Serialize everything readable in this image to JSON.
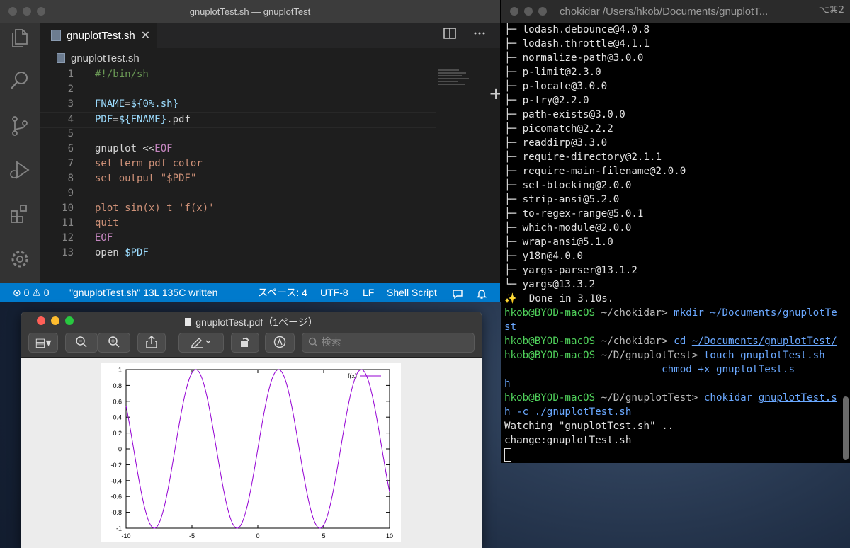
{
  "vscode": {
    "window_title": "gnuplotTest.sh — gnuplotTest",
    "tab_label": "gnuplotTest.sh",
    "tab_close": "✕",
    "breadcrumb": "gnuplotTest.sh",
    "split_icon": "split-editor-icon",
    "more_icon": "more-actions-icon",
    "activity_icons": [
      "explorer-icon",
      "search-icon",
      "source-control-icon",
      "run-debug-icon",
      "extensions-icon",
      "settings-gear-icon"
    ],
    "lines": [
      {
        "n": "1",
        "tokens": [
          {
            "t": "#!/bin/sh",
            "c": "c-comment"
          }
        ]
      },
      {
        "n": "2",
        "tokens": []
      },
      {
        "n": "3",
        "tokens": [
          {
            "t": "FNAME",
            "c": "c-var"
          },
          {
            "t": "=",
            "c": ""
          },
          {
            "t": "${0%.sh}",
            "c": "c-var"
          }
        ]
      },
      {
        "n": "4",
        "tokens": [
          {
            "t": "PDF",
            "c": "c-var"
          },
          {
            "t": "=",
            "c": ""
          },
          {
            "t": "${FNAME}",
            "c": "c-var"
          },
          {
            "t": ".pdf",
            "c": ""
          }
        ]
      },
      {
        "n": "5",
        "tokens": []
      },
      {
        "n": "6",
        "tokens": [
          {
            "t": "gnuplot <<",
            "c": ""
          },
          {
            "t": "EOF",
            "c": "c-kw"
          }
        ]
      },
      {
        "n": "7",
        "tokens": [
          {
            "t": "set term pdf color",
            "c": "c-orange"
          }
        ]
      },
      {
        "n": "8",
        "tokens": [
          {
            "t": "set output \"$PDF\"",
            "c": "c-orange"
          }
        ]
      },
      {
        "n": "9",
        "tokens": []
      },
      {
        "n": "10",
        "tokens": [
          {
            "t": "plot sin(x) t 'f(x)'",
            "c": "c-orange"
          }
        ]
      },
      {
        "n": "11",
        "tokens": [
          {
            "t": "quit",
            "c": "c-orange"
          }
        ]
      },
      {
        "n": "12",
        "tokens": [
          {
            "t": "EOF",
            "c": "c-kw"
          }
        ]
      },
      {
        "n": "13",
        "tokens": [
          {
            "t": "open ",
            "c": ""
          },
          {
            "t": "$PDF",
            "c": "c-var"
          }
        ]
      }
    ],
    "status": {
      "problems": "⊗ 0 ⚠ 0",
      "message": "\"gnuplotTest.sh\" 13L 135C written",
      "spaces": "スペース: 4",
      "encoding": "UTF-8",
      "eol": "LF",
      "language": "Shell Script"
    }
  },
  "terminal": {
    "title": "chokidar /Users/hkob/Documents/gnuplotT...",
    "shortcut": "⌥⌘2",
    "lines": [
      [
        {
          "t": "├─ lodash.debounce@4.0.8",
          "c": ""
        }
      ],
      [
        {
          "t": "├─ lodash.throttle@4.1.1",
          "c": ""
        }
      ],
      [
        {
          "t": "├─ normalize-path@3.0.0",
          "c": ""
        }
      ],
      [
        {
          "t": "├─ p-limit@2.3.0",
          "c": ""
        }
      ],
      [
        {
          "t": "├─ p-locate@3.0.0",
          "c": ""
        }
      ],
      [
        {
          "t": "├─ p-try@2.2.0",
          "c": ""
        }
      ],
      [
        {
          "t": "├─ path-exists@3.0.0",
          "c": ""
        }
      ],
      [
        {
          "t": "├─ picomatch@2.2.2",
          "c": ""
        }
      ],
      [
        {
          "t": "├─ readdirp@3.3.0",
          "c": ""
        }
      ],
      [
        {
          "t": "├─ require-directory@2.1.1",
          "c": ""
        }
      ],
      [
        {
          "t": "├─ require-main-filename@2.0.0",
          "c": ""
        }
      ],
      [
        {
          "t": "├─ set-blocking@2.0.0",
          "c": ""
        }
      ],
      [
        {
          "t": "├─ strip-ansi@5.2.0",
          "c": ""
        }
      ],
      [
        {
          "t": "├─ to-regex-range@5.0.1",
          "c": ""
        }
      ],
      [
        {
          "t": "├─ which-module@2.0.0",
          "c": ""
        }
      ],
      [
        {
          "t": "├─ wrap-ansi@5.1.0",
          "c": ""
        }
      ],
      [
        {
          "t": "├─ y18n@4.0.0",
          "c": ""
        }
      ],
      [
        {
          "t": "├─ yargs-parser@13.1.2",
          "c": ""
        }
      ],
      [
        {
          "t": "└─ yargs@13.3.2",
          "c": ""
        }
      ],
      [
        {
          "t": "✨  Done in 3.10s.",
          "c": ""
        }
      ],
      [
        {
          "t": "hkob@BYOD-macOS",
          "c": "t-green"
        },
        {
          "t": " ~/chokidar> ",
          "c": "t-prompt"
        },
        {
          "t": "mkdir ",
          "c": "t-blue"
        },
        {
          "t": "~/Documents/gnuplotTe",
          "c": "t-blue"
        }
      ],
      [
        {
          "t": "st",
          "c": "t-blue"
        }
      ],
      [
        {
          "t": "hkob@BYOD-macOS",
          "c": "t-green"
        },
        {
          "t": " ~/chokidar> ",
          "c": "t-prompt"
        },
        {
          "t": "cd ",
          "c": "t-blue"
        },
        {
          "t": "~/Documents/gnuplotTest/",
          "c": "t-blue t-under"
        }
      ],
      [
        {
          "t": "hkob@BYOD-macOS",
          "c": "t-green"
        },
        {
          "t": " ~/D/gnuplotTest> ",
          "c": "t-prompt"
        },
        {
          "t": "touch ",
          "c": "t-blue"
        },
        {
          "t": "gnuplotTest.sh",
          "c": "t-blue"
        }
      ],
      [
        {
          "t": "                          chmod ",
          "c": "t-blue"
        },
        {
          "t": "+x gnuplotTest.s",
          "c": "t-blue"
        }
      ],
      [
        {
          "t": "h",
          "c": "t-blue"
        }
      ],
      [
        {
          "t": "hkob@BYOD-macOS",
          "c": "t-green"
        },
        {
          "t": " ~/D/gnuplotTest> ",
          "c": "t-prompt"
        },
        {
          "t": "chokidar ",
          "c": "t-blue"
        },
        {
          "t": "gnuplotTest.s",
          "c": "t-blue t-under"
        }
      ],
      [
        {
          "t": "h",
          "c": "t-blue t-under"
        },
        {
          "t": " -c ",
          "c": "t-blue"
        },
        {
          "t": "./gnuplotTest.sh",
          "c": "t-blue t-under"
        }
      ],
      [
        {
          "t": "Watching \"gnuplotTest.sh\" ..",
          "c": ""
        }
      ],
      [
        {
          "t": "change:gnuplotTest.sh",
          "c": ""
        }
      ]
    ]
  },
  "preview": {
    "title": "gnuplotTest.pdf（1ページ）",
    "search_placeholder": "検索"
  },
  "chart_data": {
    "type": "line",
    "title": "",
    "xlabel": "",
    "ylabel": "",
    "xlim": [
      -10,
      10
    ],
    "ylim": [
      -1,
      1
    ],
    "xticks": [
      "-10",
      "-5",
      "0",
      "5",
      "10"
    ],
    "yticks": [
      "1",
      "0.8",
      "0.6",
      "0.4",
      "0.2",
      "0",
      "-0.2",
      "-0.4",
      "-0.6",
      "-0.8",
      "-1"
    ],
    "series": [
      {
        "name": "f(x)",
        "color": "#9400d3",
        "function": "sin(x)",
        "x": [
          -10,
          -9,
          -8,
          -7,
          -6,
          -5,
          -4,
          -3,
          -2,
          -1,
          0,
          1,
          2,
          3,
          4,
          5,
          6,
          7,
          8,
          9,
          10
        ],
        "values": [
          0.544,
          -0.412,
          -0.989,
          -0.657,
          0.279,
          0.959,
          0.757,
          -0.141,
          -0.909,
          -0.841,
          0,
          0.841,
          0.909,
          0.141,
          -0.757,
          -0.959,
          -0.279,
          0.657,
          0.989,
          0.412,
          -0.544
        ]
      }
    ],
    "legend": "top-right",
    "grid": false
  }
}
